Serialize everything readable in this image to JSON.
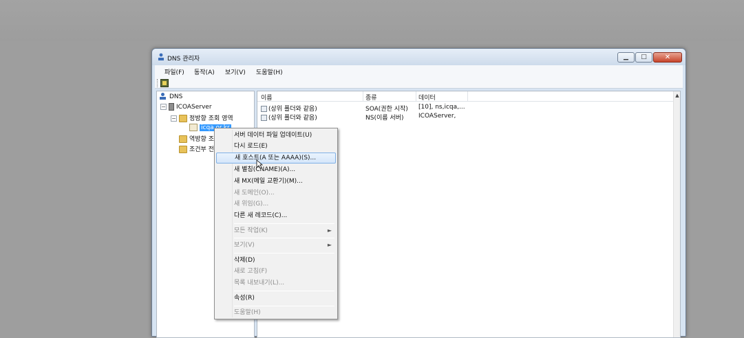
{
  "window": {
    "title": "DNS 관리자",
    "controls": {
      "minimize": "▁",
      "maximize": "□",
      "close": "✕"
    }
  },
  "menubar": {
    "items": [
      "파일(F)",
      "동작(A)",
      "보기(V)",
      "도움말(H)"
    ]
  },
  "tree": {
    "root": "DNS",
    "server": "ICOAServer",
    "forward_zones": "정방향 조회 영역",
    "zone_selected": "icqa.or.kr",
    "reverse_zones": "역방향 조",
    "conditional": "조건부 전"
  },
  "list": {
    "columns": [
      "이름",
      "종류",
      "데이터"
    ],
    "rows": [
      {
        "name": "(상위 폴더와 같음)",
        "type": "SOA(권한 시작)",
        "data": "[10], ns,icqa,..."
      },
      {
        "name": "(상위 폴더와 같음)",
        "type": "NS(이름 서버)",
        "data": "ICOAServer,"
      }
    ]
  },
  "context_menu": {
    "items": [
      {
        "label": "서버 데이터 파일 업데이트(U)",
        "disabled": false
      },
      {
        "label": "다시 로드(E)",
        "disabled": false
      },
      {
        "label": "새 호스트(A 또는 AAAA)(S)...",
        "disabled": false,
        "highlighted": true
      },
      {
        "label": "새 별칭(CNAME)(A)...",
        "disabled": false
      },
      {
        "label": "새 MX(메일 교환기)(M)...",
        "disabled": false
      },
      {
        "label": "새 도메인(O)...",
        "disabled": true
      },
      {
        "label": "새 위임(G)...",
        "disabled": true
      },
      {
        "label": "다른 새 레코드(C)...",
        "disabled": false
      },
      {
        "label": "모든 작업(K)",
        "disabled": true,
        "submenu": true
      },
      {
        "label": "보기(V)",
        "disabled": true,
        "submenu": true
      },
      {
        "label": "삭제(D)",
        "disabled": false
      },
      {
        "label": "새로 고침(F)",
        "disabled": true
      },
      {
        "label": "목록 내보내기(L)...",
        "disabled": true
      },
      {
        "label": "속성(R)",
        "disabled": false
      },
      {
        "label": "도움말(H)",
        "disabled": true
      }
    ],
    "submenu_arrow": "►"
  },
  "icons": {
    "dns": "dns-icon",
    "server": "server-icon",
    "folder": "folder-icon",
    "zone": "zone-icon",
    "toolbar": "console-icon"
  }
}
